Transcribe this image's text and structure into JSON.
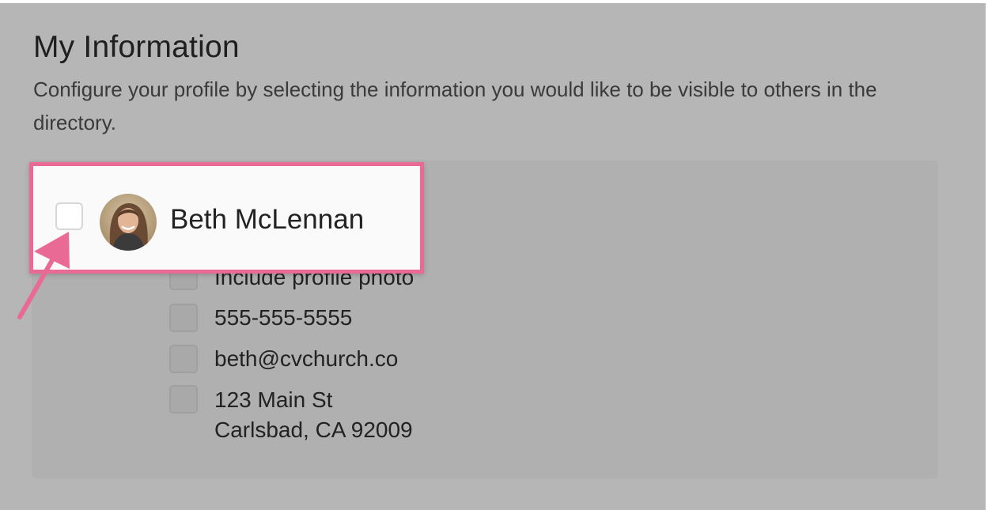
{
  "section": {
    "title": "My Information",
    "description": "Configure your profile by selecting the information you would like to be visible to others in the directory."
  },
  "profile": {
    "name": "Beth McLennan",
    "options": [
      {
        "label": "Include profile photo",
        "checked": false
      },
      {
        "label": "555-555-5555",
        "checked": false
      },
      {
        "label": "beth@cvchurch.co",
        "checked": false
      },
      {
        "label_line1": "123 Main St",
        "label_line2": "Carlsbad, CA 92009",
        "checked": false
      }
    ]
  },
  "colors": {
    "highlight": "#e86a95",
    "overlay": "#b6b6b6"
  },
  "icons": {
    "annotation": "arrow-icon",
    "avatar": "avatar-photo"
  }
}
